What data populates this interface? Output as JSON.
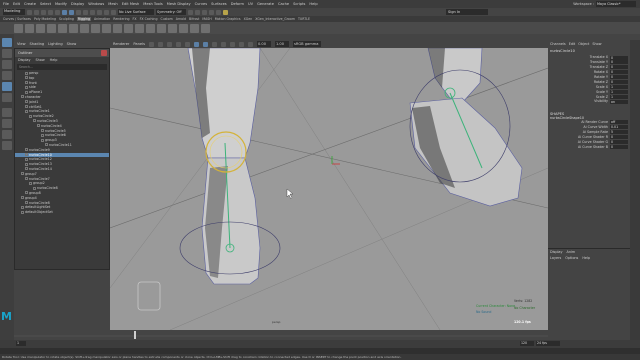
{
  "menubar": {
    "items": [
      "File",
      "Edit",
      "Create",
      "Select",
      "Modify",
      "Display",
      "Windows",
      "Mesh",
      "Edit Mesh",
      "Mesh Tools",
      "Mesh Display",
      "Curves",
      "Surfaces",
      "Deform",
      "UV",
      "Generate",
      "Cache",
      "Scripts",
      "Help"
    ],
    "workspace_label": "Workspace :",
    "workspace_value": "Maya Classic*"
  },
  "statusline": {
    "mode": "Modeling",
    "live_surface": "No Live Surface",
    "symmetry": "Symmetry: Off",
    "sign_in": "Sign In"
  },
  "shelf_tabs": [
    "Curves / Surfaces",
    "Poly Modeling",
    "Sculpting",
    "Rigging",
    "Animation",
    "Rendering",
    "FX",
    "FX Caching",
    "Custom",
    "Arnold",
    "Bifrost",
    "MASH",
    "Motion Graphics",
    "XGen",
    "XGen_Interactive_Groom",
    "TURTLE"
  ],
  "shelf_active": "Rigging",
  "panel_menu": [
    "View",
    "Shading",
    "Lighting",
    "Show",
    "Renderer",
    "Panels"
  ],
  "viewport": {
    "field_values": [
      "0.00",
      "1.00"
    ],
    "colorspace": "sRGB gamma",
    "camera_label": "persp",
    "hud": {
      "summary_lines": [
        "Current Character: None",
        "No Character",
        "No Sound"
      ],
      "vertex_label": "Verts:",
      "vertex_value": "1282",
      "fps": "120.1 fps"
    },
    "colors": {
      "background": "#9a9a9a",
      "mesh": "#5a5fa0",
      "selection": "#d4b33a"
    }
  },
  "outliner": {
    "title": "Outliner",
    "menu": [
      "Display",
      "Show",
      "Help"
    ],
    "search_placeholder": "Search...",
    "rows": [
      {
        "label": "persp",
        "indent": 2,
        "selected": false
      },
      {
        "label": "top",
        "indent": 2,
        "selected": false
      },
      {
        "label": "front",
        "indent": 2,
        "selected": false
      },
      {
        "label": "side",
        "indent": 2,
        "selected": false
      },
      {
        "label": "aPlane1",
        "indent": 2,
        "selected": false
      },
      {
        "label": "character",
        "indent": 1,
        "selected": false
      },
      {
        "label": "joint1",
        "indent": 2,
        "selected": false
      },
      {
        "label": "ctrlSet1",
        "indent": 2,
        "selected": false
      },
      {
        "label": "nurbsCircle1",
        "indent": 2,
        "selected": false
      },
      {
        "label": "nurbsCircle2",
        "indent": 3,
        "selected": false
      },
      {
        "label": "nurbsCircle3",
        "indent": 4,
        "selected": false
      },
      {
        "label": "nurbsCircle4",
        "indent": 5,
        "selected": false
      },
      {
        "label": "nurbsCircle5",
        "indent": 6,
        "selected": false
      },
      {
        "label": "nurbsCircle6",
        "indent": 6,
        "selected": false
      },
      {
        "label": "group3",
        "indent": 6,
        "selected": false
      },
      {
        "label": "nurbsCircle11",
        "indent": 7,
        "selected": false
      },
      {
        "label": "nurbsCircle9",
        "indent": 2,
        "selected": false
      },
      {
        "label": "nurbsCircle10",
        "indent": 2,
        "selected": true
      },
      {
        "label": "nurbsCircle12",
        "indent": 2,
        "selected": false
      },
      {
        "label": "nurbsCircle13",
        "indent": 2,
        "selected": false
      },
      {
        "label": "nurbsCircle14",
        "indent": 2,
        "selected": false
      },
      {
        "label": "group7",
        "indent": 1,
        "selected": false
      },
      {
        "label": "nurbsCircle7",
        "indent": 2,
        "selected": false
      },
      {
        "label": "group2",
        "indent": 3,
        "selected": false
      },
      {
        "label": "nurbsCircle8",
        "indent": 4,
        "selected": false
      },
      {
        "label": "group8",
        "indent": 2,
        "selected": false
      },
      {
        "label": "group4",
        "indent": 1,
        "selected": false
      },
      {
        "label": "nurbsCircle8",
        "indent": 2,
        "selected": false
      },
      {
        "label": "defaultLightSet",
        "indent": 1,
        "selected": false
      },
      {
        "label": "defaultObjectSet",
        "indent": 1,
        "selected": false
      }
    ]
  },
  "channel_box": {
    "tabs": [
      "Channels",
      "Edit",
      "Object",
      "Show"
    ],
    "object": "nurbsCircle10",
    "attrs": [
      {
        "label": "Translate X",
        "value": "0"
      },
      {
        "label": "Translate Y",
        "value": "0"
      },
      {
        "label": "Translate Z",
        "value": "0"
      },
      {
        "label": "Rotate X",
        "value": "0"
      },
      {
        "label": "Rotate Y",
        "value": "0"
      },
      {
        "label": "Rotate Z",
        "value": "0"
      },
      {
        "label": "Scale X",
        "value": "1"
      },
      {
        "label": "Scale Y",
        "value": "1"
      },
      {
        "label": "Scale Z",
        "value": "1"
      },
      {
        "label": "Visibility",
        "value": "on"
      }
    ],
    "shapes_label": "SHAPES",
    "shape_name": "nurbsCircleShape10",
    "shape_attrs": [
      {
        "label": "Ai Render Curve",
        "value": "off"
      },
      {
        "label": "Ai Curve Width",
        "value": "0.01"
      },
      {
        "label": "Ai Sample Rate",
        "value": "5"
      },
      {
        "label": "Ai Curve Shader R",
        "value": "0"
      },
      {
        "label": "Ai Curve Shader G",
        "value": "0"
      },
      {
        "label": "Ai Curve Shader B",
        "value": "0"
      }
    ]
  },
  "layers": {
    "tabs": [
      "Display",
      "Anim"
    ],
    "menu": [
      "Layers",
      "Options",
      "Help"
    ]
  },
  "range": {
    "start": "1",
    "end": "120",
    "character_set": "No Character Set",
    "anim_layer": "No Anim Layer",
    "fps": "24 fps"
  },
  "help_line": "Rotate Tool: Use manipulator to rotate object(s). Shift+drag manipulator axis or plane handles to extrude components or clone objects. Ctrl+LMB+Shift drag to constrain rotation to connected edges. Use D or INSERT to change the pivot position and axis orientation."
}
